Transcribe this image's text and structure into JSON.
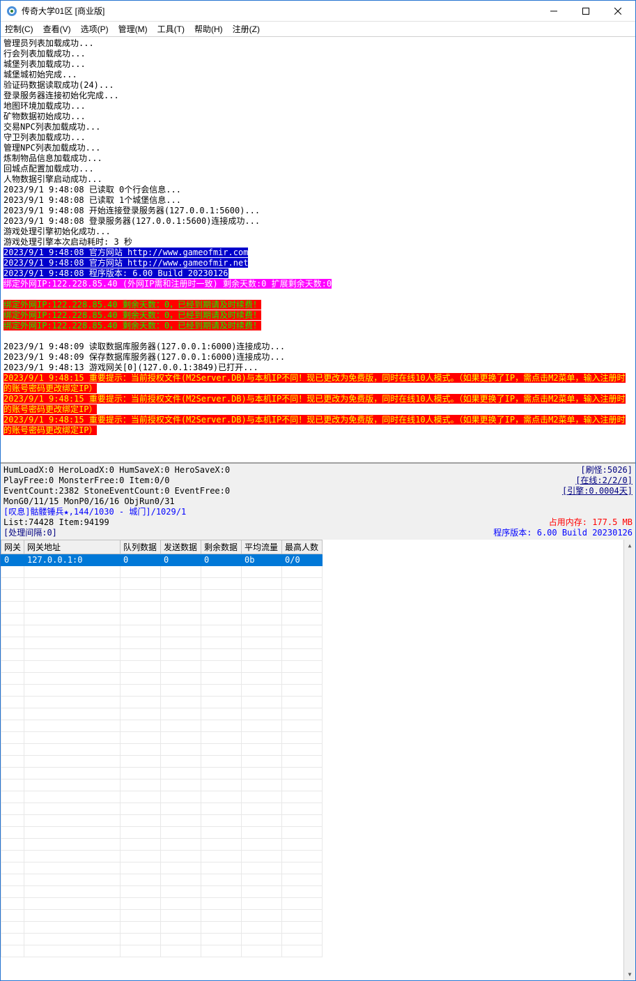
{
  "window": {
    "title": "传奇大学01区  [商业版]"
  },
  "menu": {
    "control": "控制(C)",
    "view": "查看(V)",
    "options": "选项(P)",
    "manage": "管理(M)",
    "tools": "工具(T)",
    "help": "帮助(H)",
    "register": "注册(Z)"
  },
  "log_lines": [
    {
      "t": "管理员列表加载成功..."
    },
    {
      "t": "行会列表加载成功..."
    },
    {
      "t": "城堡列表加载成功..."
    },
    {
      "t": "城堡城初始完成..."
    },
    {
      "t": "验证码数据读取成功(24)..."
    },
    {
      "t": "登录服务器连接初始化完成..."
    },
    {
      "t": "地图环境加载成功..."
    },
    {
      "t": "矿物数据初始成功..."
    },
    {
      "t": "交易NPC列表加载成功..."
    },
    {
      "t": "守卫列表加载成功..."
    },
    {
      "t": "管理NPC列表加载成功..."
    },
    {
      "t": "炼制物品信息加载成功..."
    },
    {
      "t": "回城点配置加载成功..."
    },
    {
      "t": "人物数据引擎启动成功..."
    },
    {
      "t": "2023/9/1 9:48:08 已读取 0个行会信息..."
    },
    {
      "t": "2023/9/1 9:48:08 已读取 1个城堡信息..."
    },
    {
      "t": "2023/9/1 9:48:08 开始连接登录服务器(127.0.0.1:5600)..."
    },
    {
      "t": "2023/9/1 9:48:08 登录服务器(127.0.0.1:5600)连接成功..."
    },
    {
      "t": "游戏处理引擎初始化成功..."
    },
    {
      "t": "游戏处理引擎本次启动耗时: 3 秒"
    },
    {
      "t": "2023/9/1 9:48:08 官方网站 http://www.gameofmir.com",
      "c": "l-blue"
    },
    {
      "t": "2023/9/1 9:48:08 官方网站 http://www.gameofmir.net",
      "c": "l-blue"
    },
    {
      "t": "2023/9/1 9:48:08 程序版本: 6.00 Build 20230126",
      "c": "l-blue"
    },
    {
      "t": "绑定外网IP:122.228.85.40 (外网IP需和注册时一致) 剩余天数:0 扩展剩余天数:0",
      "c": "l-mag"
    },
    {
      "t": " "
    },
    {
      "t": "绑定外网IP:122.228.85.40 剩余天数：0，已经到期请及时续费！",
      "c": "l-red-bright"
    },
    {
      "t": "绑定外网IP:122.228.85.40 剩余天数：0，已经到期请及时续费！",
      "c": "l-red-bright"
    },
    {
      "t": "绑定外网IP:122.228.85.40 剩余天数：0，已经到期请及时续费！",
      "c": "l-red-bright"
    },
    {
      "t": " "
    },
    {
      "t": "2023/9/1 9:48:09 读取数据库服务器(127.0.0.1:6000)连接成功..."
    },
    {
      "t": "2023/9/1 9:48:09 保存数据库服务器(127.0.0.1:6000)连接成功..."
    },
    {
      "t": "2023/9/1 9:48:13 游戏网关[0](127.0.0.1:3849)已打开..."
    },
    {
      "t": "2023/9/1 9:48:15 重要提示：当前授权文件(M2Server.DB)与本机IP不同！现已更改为免费版，同时在线10人模式。（如果更换了IP，需点击M2菜单，输入注册时的账号密码更改绑定IP）",
      "c": "l-red-ylw",
      "wrap": true
    },
    {
      "t": "2023/9/1 9:48:15 重要提示：当前授权文件(M2Server.DB)与本机IP不同！现已更改为免费版，同时在线10人模式。（如果更换了IP，需点击M2菜单，输入注册时的账号密码更改绑定IP）",
      "c": "l-red-ylw",
      "wrap": true
    },
    {
      "t": "2023/9/1 9:48:15 重要提示：当前授权文件(M2Server.DB)与本机IP不同！现已更改为免费版，同时在线10人模式。（如果更换了IP，需点击M2菜单，输入注册时的账号密码更改绑定IP）",
      "c": "l-red-ylw",
      "wrap": true
    }
  ],
  "status": {
    "line1_left": "HumLoadX:0 HeroLoadX:0 HumSaveX:0 HeroSaveX:0",
    "line1_right": "[刷怪:5026]",
    "line2_left": "PlayFree:0 MonsterFree:0 Item:0/0",
    "line2_right": "[在线:2/2/0]",
    "line3_left": "EventCount:2382 StoneEventCount:0 EventFree:0",
    "line3_right": "[引擎:0.0004天]",
    "line4": "MonG0/11/15 MonP0/16/16 ObjRun0/31",
    "line5": "[叹息]骷髅锤兵★,144/1030 - 城门]/1029/1",
    "line6_left": "List:74428 Item:94199",
    "line6_right": "占用内存: 177.5 MB",
    "line7_left": "[处理间隔:0]",
    "line7_right": "程序版本: 6.00 Build 20230126"
  },
  "table": {
    "headers": {
      "c0": "网关",
      "c1": "网关地址",
      "c2": "队列数据",
      "c3": "发送数据",
      "c4": "剩余数据",
      "c5": "平均流量",
      "c6": "最高人数"
    },
    "row": {
      "c0": "0",
      "c1": "127.0.0.1:0",
      "c2": "0",
      "c3": "0",
      "c4": "0",
      "c5": "0b",
      "c6": "0/0"
    }
  }
}
